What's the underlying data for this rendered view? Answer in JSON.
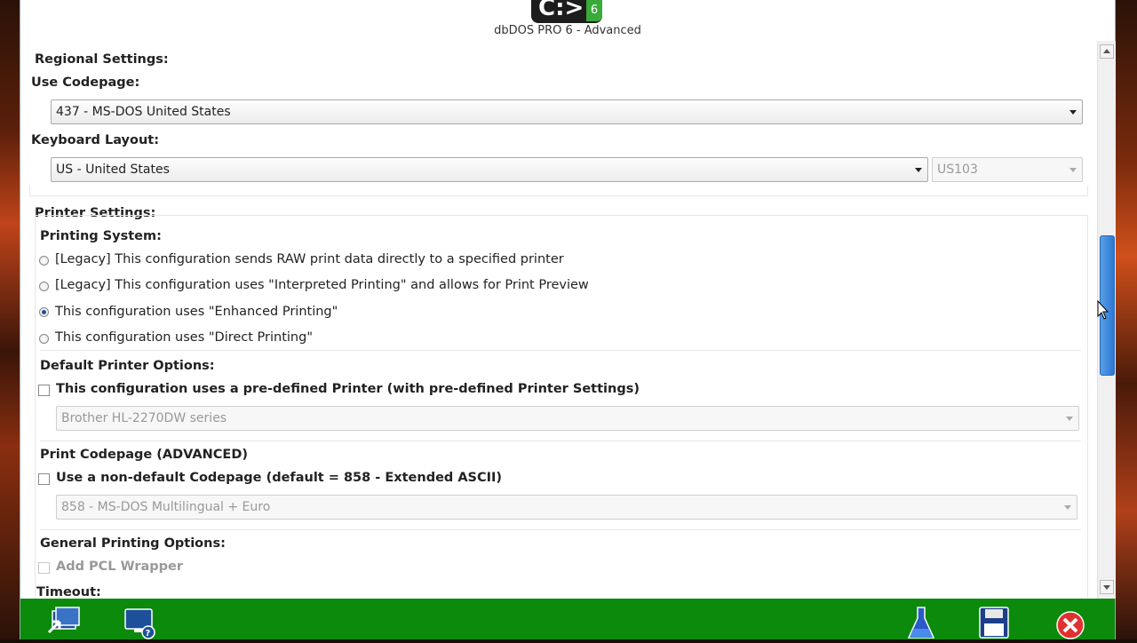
{
  "app": {
    "title": "dbDOS PRO 6 - Advanced",
    "logo_text": "C:>",
    "logo_badge": "6"
  },
  "regional": {
    "section_label": "Regional Settings:",
    "codepage_label": "Use Codepage:",
    "codepage_value": "437 - MS-DOS United States",
    "keyboard_label": "Keyboard Layout:",
    "keyboard_value": "US - United States",
    "keyboard_variant": "US103"
  },
  "printer": {
    "section_label": "Printer Settings:",
    "printing_system_label": "Printing System:",
    "options": [
      {
        "label": "[Legacy] This configuration sends RAW print data directly to a specified printer",
        "checked": false
      },
      {
        "label": "[Legacy] This configuration uses \"Interpreted Printing\" and allows for Print Preview",
        "checked": false
      },
      {
        "label": "This configuration uses \"Enhanced Printing\"",
        "checked": true
      },
      {
        "label": "This configuration uses \"Direct Printing\"",
        "checked": false
      }
    ],
    "default_options_label": "Default Printer Options:",
    "predefined_label": "This configuration uses a pre-defined Printer (with pre-defined Printer Settings)",
    "predefined_printer": "Brother HL-2270DW series",
    "codepage_section_label": "Print Codepage (ADVANCED)",
    "nondefault_label": "Use a non-default Codepage (default = 858 - Extended ASCII)",
    "print_codepage_value": "858 - MS-DOS Multilingual + Euro",
    "general_label": "General Printing Options:",
    "pcl_label": "Add PCL Wrapper",
    "timeout_label": "Timeout:"
  },
  "colors": {
    "bottom_bar": "#0b8a0b",
    "scroll_thumb": "#2a78d4",
    "radio_selected": "#1f4e9a"
  },
  "bottom_icons": [
    "import-icon",
    "help-monitor-icon",
    "flask-icon",
    "save-disk-icon",
    "close-icon"
  ]
}
